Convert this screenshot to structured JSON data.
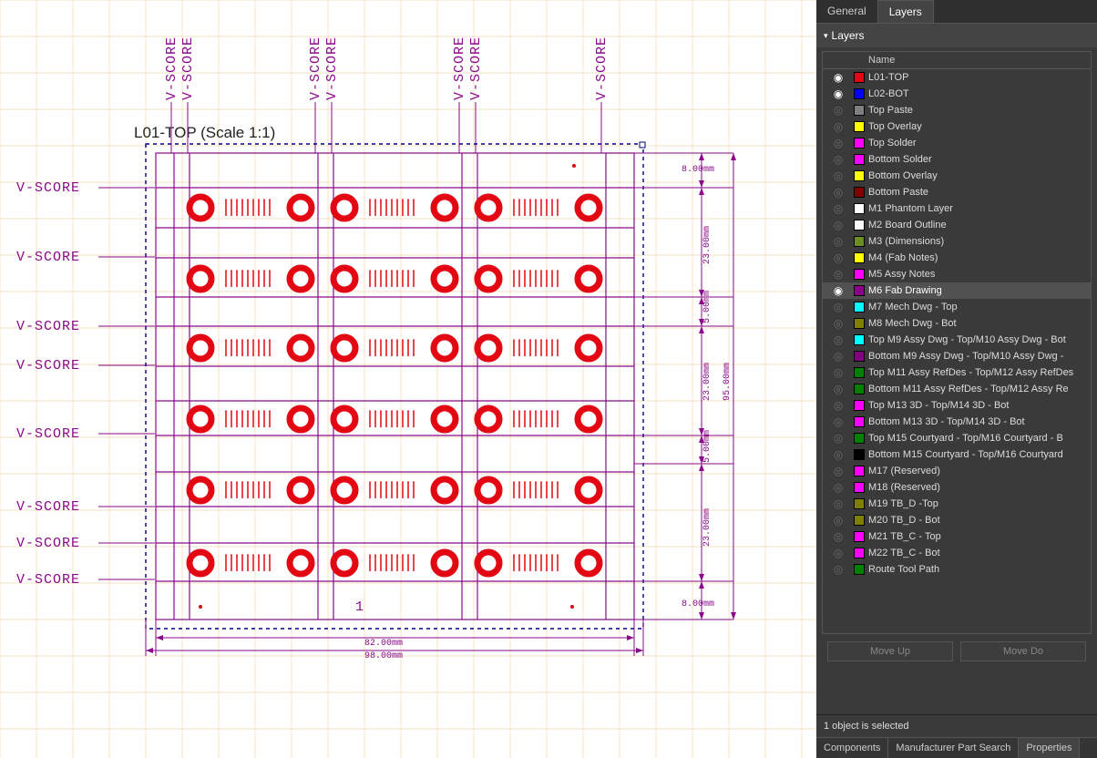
{
  "tabs": {
    "general": "General",
    "layers": "Layers"
  },
  "section_title": "Layers",
  "columns": {
    "name": "Name"
  },
  "layers": [
    {
      "vis": true,
      "color": "#e30613",
      "name": "L01-TOP"
    },
    {
      "vis": true,
      "color": "#0000ff",
      "name": "L02-BOT"
    },
    {
      "vis": false,
      "color": "#808080",
      "name": "Top Paste"
    },
    {
      "vis": false,
      "color": "#ffff00",
      "name": "Top Overlay"
    },
    {
      "vis": false,
      "color": "#ff00ff",
      "name": "Top Solder"
    },
    {
      "vis": false,
      "color": "#ff00ff",
      "name": "Bottom Solder"
    },
    {
      "vis": false,
      "color": "#ffff00",
      "name": "Bottom Overlay"
    },
    {
      "vis": false,
      "color": "#800000",
      "name": "Bottom Paste"
    },
    {
      "vis": false,
      "color": "#ffffff",
      "name": "M1 Phantom Layer"
    },
    {
      "vis": false,
      "color": "#ffffff",
      "name": "M2 Board Outline"
    },
    {
      "vis": false,
      "color": "#6b8e23",
      "name": "M3 (Dimensions)"
    },
    {
      "vis": false,
      "color": "#ffff00",
      "name": "M4 (Fab Notes)"
    },
    {
      "vis": false,
      "color": "#ff00ff",
      "name": "M5 Assy Notes"
    },
    {
      "vis": true,
      "color": "#8a008a",
      "name": "M6 Fab Drawing",
      "selected": true
    },
    {
      "vis": false,
      "color": "#00ffff",
      "name": "M7 Mech Dwg - Top"
    },
    {
      "vis": false,
      "color": "#808000",
      "name": "M8 Mech Dwg - Bot"
    },
    {
      "vis": false,
      "color": "#00ffff",
      "name": "Top M9 Assy Dwg - Top/M10 Assy Dwg - Bot"
    },
    {
      "vis": false,
      "color": "#800080",
      "name": "Bottom M9 Assy Dwg - Top/M10 Assy Dwg -"
    },
    {
      "vis": false,
      "color": "#008000",
      "name": "Top M11 Assy RefDes - Top/M12 Assy RefDes"
    },
    {
      "vis": false,
      "color": "#008000",
      "name": "Bottom M11 Assy RefDes - Top/M12 Assy Re"
    },
    {
      "vis": false,
      "color": "#ff00ff",
      "name": "Top M13 3D - Top/M14 3D - Bot"
    },
    {
      "vis": false,
      "color": "#ff00ff",
      "name": "Bottom M13 3D - Top/M14 3D - Bot"
    },
    {
      "vis": false,
      "color": "#008000",
      "name": "Top M15 Courtyard - Top/M16 Courtyard - B"
    },
    {
      "vis": false,
      "color": "#000000",
      "name": "Bottom M15 Courtyard - Top/M16 Courtyard"
    },
    {
      "vis": false,
      "color": "#ff00ff",
      "name": "M17 (Reserved)"
    },
    {
      "vis": false,
      "color": "#ff00ff",
      "name": "M18 (Reserved)"
    },
    {
      "vis": false,
      "color": "#808000",
      "name": "M19 TB_D -Top"
    },
    {
      "vis": false,
      "color": "#808000",
      "name": "M20 TB_D - Bot"
    },
    {
      "vis": false,
      "color": "#ff00ff",
      "name": "M21 TB_C - Top"
    },
    {
      "vis": false,
      "color": "#ff00ff",
      "name": "M22 TB_C - Bot"
    },
    {
      "vis": false,
      "color": "#008000",
      "name": "Route Tool Path"
    }
  ],
  "buttons": {
    "move_up": "Move Up",
    "move_down": "Move Do"
  },
  "status": "1 object is selected",
  "bottom_tabs": [
    "Components",
    "Manufacturer Part Search",
    "Properties"
  ],
  "canvas": {
    "title": "L01-TOP (Scale 1:1)",
    "vscore": "V-SCORE",
    "dims": {
      "d8": "8.00mm",
      "d23": "23.00mm",
      "d5": "5.00mm",
      "d95": "95.00mm",
      "d82": "82.00mm",
      "d98": "98.00mm"
    },
    "marker": "1"
  }
}
